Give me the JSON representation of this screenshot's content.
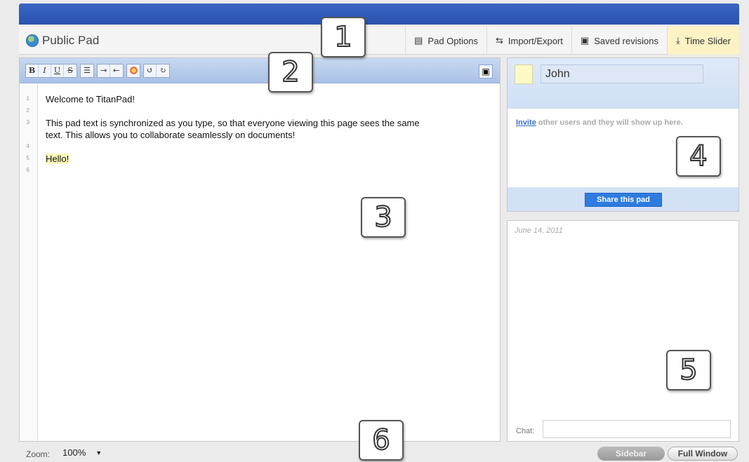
{
  "header": {
    "pad_title": "Public Pad",
    "menu": [
      {
        "label": "Pad Options",
        "icon": "document-icon"
      },
      {
        "label": "Import/Export",
        "icon": "swap-arrows-icon"
      },
      {
        "label": "Saved revisions",
        "icon": "save-icon"
      },
      {
        "label": "Time Slider",
        "icon": "time-slider-icon"
      }
    ]
  },
  "annotations": [
    "1",
    "2",
    "3",
    "4",
    "5",
    "6"
  ],
  "toolbar": {
    "bold": "B",
    "italic": "I",
    "underline": "U",
    "strikethrough": "S"
  },
  "editor": {
    "line_numbers": [
      "1",
      "2",
      "3",
      "4",
      "5",
      "6"
    ],
    "lines": [
      "Welcome to TitanPad!",
      "This pad text is synchronized as you type, so that everyone viewing this page sees the same",
      "text.  This allows you to collaborate seamlessly on documents!",
      "Hello!"
    ]
  },
  "users": {
    "my_name": "John",
    "invite_link": "Invite",
    "invite_text": " other users and they will show up here.",
    "share_button": "Share this pad"
  },
  "chat": {
    "date": "June 14, 2011",
    "label": "Chat:"
  },
  "footer": {
    "zoom_label": "Zoom:",
    "zoom_value": "100%",
    "sidebar_button": "Sidebar",
    "full_window_button": "Full Window"
  },
  "colors": {
    "topbar": "#3a66c4",
    "time_slider_bg": "#fcf2c4",
    "share_button": "#2f7be0",
    "highlight": "#fbfab7"
  }
}
